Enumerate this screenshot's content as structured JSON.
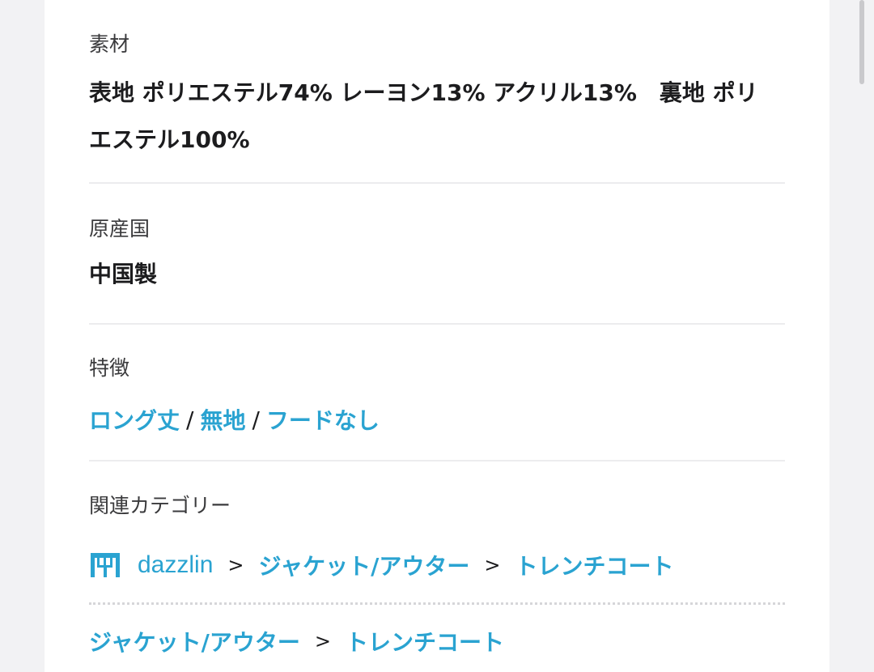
{
  "material": {
    "label": "素材",
    "value": "表地 ポリエステル74% レーヨン13% アクリル13%　裏地 ポリエステル100%"
  },
  "origin": {
    "label": "原産国",
    "value": "中国製"
  },
  "features": {
    "label": "特徴",
    "items": [
      "ロング丈",
      "無地",
      "フードなし"
    ],
    "separator": "/"
  },
  "categories": {
    "label": "関連カテゴリー",
    "row1": {
      "shop_icon": "shop-icon",
      "shop": "dazzlin",
      "cat1": "ジャケット/アウター",
      "cat2": "トレンチコート"
    },
    "row2": {
      "cat1": "ジャケット/アウター",
      "cat2": "トレンチコート"
    },
    "arrow": ">"
  },
  "colors": {
    "link": "#2aa3d1",
    "text": "#1c1c1e",
    "background": "#f2f2f4"
  }
}
